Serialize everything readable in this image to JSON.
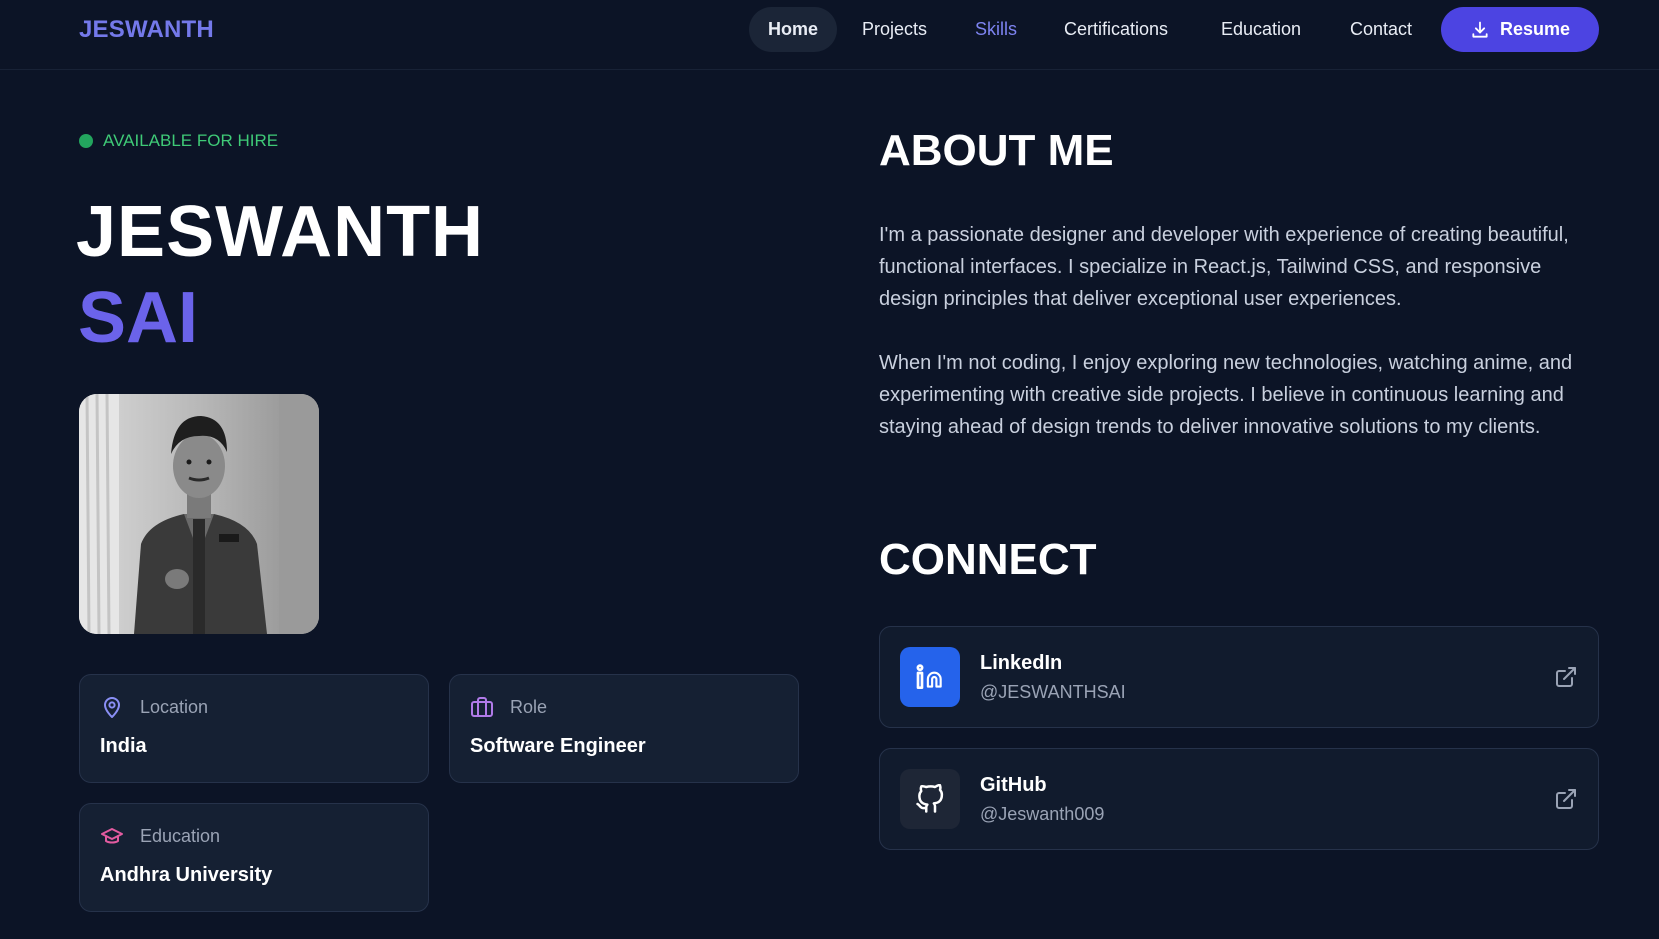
{
  "nav": {
    "logo": "JESWANTH",
    "items": [
      "Home",
      "Projects",
      "Skills",
      "Certifications",
      "Education",
      "Contact"
    ],
    "resume_label": "Resume"
  },
  "hero": {
    "availability": "AVAILABLE FOR HIRE",
    "first_name": "JESWANTH",
    "last_name": "SAI"
  },
  "info": {
    "location": {
      "label": "Location",
      "value": "India"
    },
    "role": {
      "label": "Role",
      "value": "Software Engineer"
    },
    "education": {
      "label": "Education",
      "value": "Andhra University"
    }
  },
  "about": {
    "title": "ABOUT ME",
    "paragraphs": [
      "I'm a passionate designer and developer with experience of creating beautiful, functional interfaces. I specialize in React.js, Tailwind CSS, and responsive design principles that deliver exceptional user experiences.",
      "When I'm not coding, I enjoy exploring new technologies, watching anime, and experimenting with creative side projects. I believe in continuous learning and staying ahead of design trends to deliver innovative solutions to my clients."
    ]
  },
  "connect": {
    "title": "CONNECT",
    "links": [
      {
        "title": "LinkedIn",
        "handle": "@JESWANTHSAI",
        "icon": "linkedin-icon"
      },
      {
        "title": "GitHub",
        "handle": "@Jeswanth009",
        "icon": "github-icon"
      }
    ]
  },
  "colors": {
    "background": "#0c1426",
    "accent": "#6b63ea",
    "available": "#3fca77",
    "linkedin": "#2563eb"
  }
}
